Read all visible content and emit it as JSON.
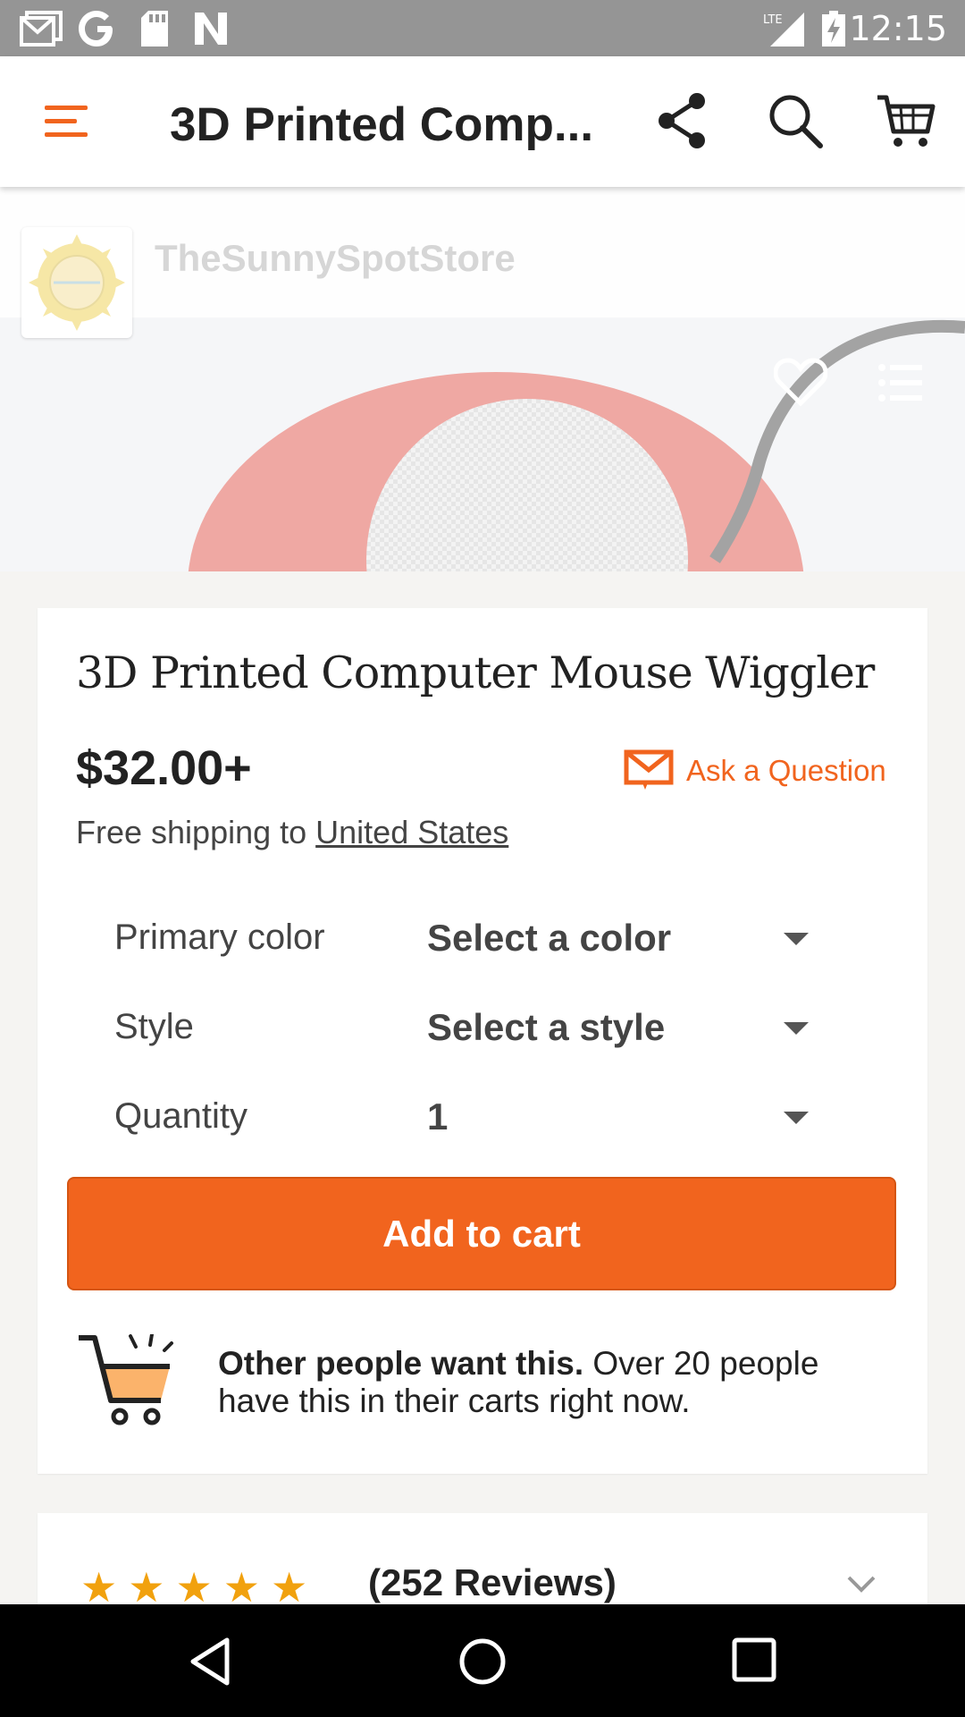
{
  "status_bar": {
    "time": "12:15",
    "network_label": "LTE"
  },
  "app_bar": {
    "title": "3D Printed Comp...",
    "menu_icon": "hamburger-icon",
    "share_icon": "share-icon",
    "search_icon": "search-icon",
    "cart_icon": "cart-icon",
    "accent_color": "#f1641e"
  },
  "shop": {
    "name": "TheSunnySpotStore"
  },
  "hero": {
    "favorite_icon": "heart-icon",
    "list_icon": "list-icon"
  },
  "product": {
    "title": "3D Printed Computer Mouse Wiggler",
    "price": "$32.00+",
    "ask_question_label": "Ask a Question",
    "shipping_prefix": "Free shipping to ",
    "shipping_destination": "United States"
  },
  "options": [
    {
      "label": "Primary color",
      "value": "Select a color"
    },
    {
      "label": "Style",
      "value": "Select a style"
    },
    {
      "label": "Quantity",
      "value": "1"
    }
  ],
  "add_to_cart": {
    "label": "Add to cart",
    "color": "#f1641e"
  },
  "promo": {
    "headline": "Other people want this.",
    "body": " Over 20 people have this in their carts right now."
  },
  "reviews": {
    "stars": "★★★★★",
    "rating": 5,
    "count_label": "(252 Reviews)"
  }
}
